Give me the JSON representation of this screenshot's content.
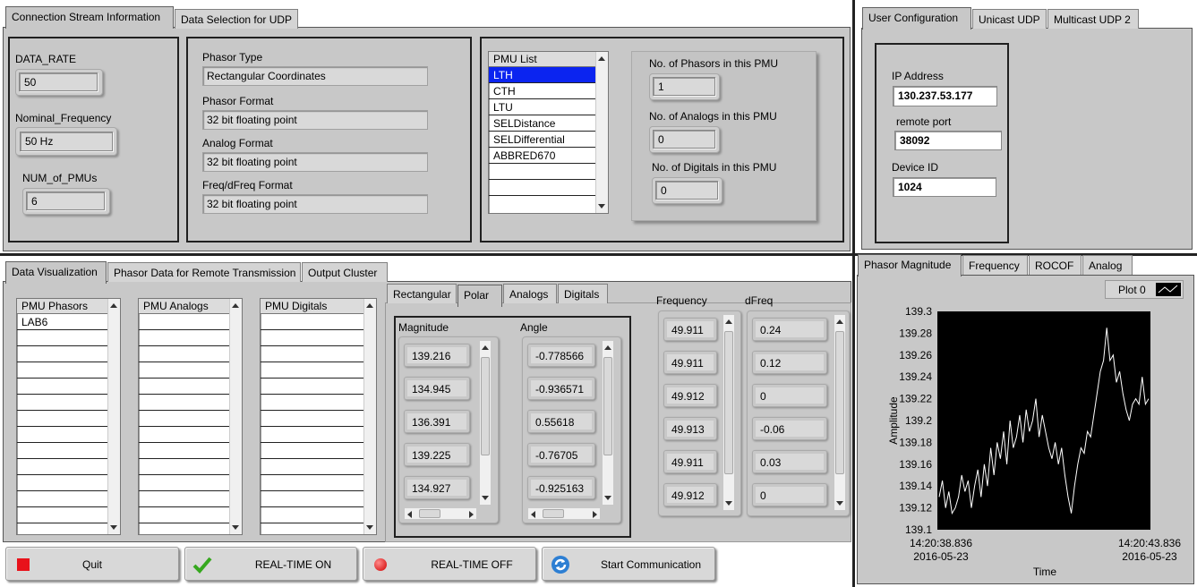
{
  "top_left_tabs": [
    "Connection Stream Information",
    "Data Selection for UDP"
  ],
  "stream": {
    "data_rate_label": "DATA_RATE",
    "data_rate": "50",
    "nominal_freq_label": "Nominal_Frequency",
    "nominal_freq": "50 Hz",
    "num_pmus_label": "NUM_of_PMUs",
    "num_pmus": "6",
    "phasor_type_label": "Phasor Type",
    "phasor_type": "Rectangular Coordinates",
    "phasor_format_label": "Phasor Format",
    "phasor_format": "32 bit floating point",
    "analog_format_label": "Analog Format",
    "analog_format": "32 bit floating point",
    "freq_format_label": "Freq/dFreq Format",
    "freq_format": "32 bit floating point"
  },
  "pmu_list": {
    "header": "PMU List",
    "items": [
      "LTH",
      "CTH",
      "LTU",
      "SELDistance",
      "SELDifferential",
      "ABBRED670"
    ],
    "selected": "LTH"
  },
  "pmu_counts": {
    "phasors_label": "No. of Phasors in this PMU",
    "phasors": "1",
    "analogs_label": "No. of Analogs in this PMU",
    "analogs": "0",
    "digitals_label": "No. of Digitals in this PMU",
    "digitals": "0"
  },
  "right_tabs": [
    "User Configuration",
    "Unicast UDP",
    "Multicast UDP 2"
  ],
  "user_config": {
    "ip_label": "IP Address",
    "ip": "130.237.53.177",
    "port_label": "remote port",
    "port": "38092",
    "device_label": "Device ID",
    "device": "1024"
  },
  "bottom_tabs": [
    "Data Visualization",
    "Phasor Data for Remote Transmission",
    "Output Cluster"
  ],
  "lists": {
    "phasors_header": "PMU Phasors",
    "phasors": [
      "LAB6"
    ],
    "analogs_header": "PMU Analogs",
    "digitals_header": "PMU Digitals"
  },
  "coord_tabs": [
    "Rectangular",
    "Polar",
    "Analogs",
    "Digitals"
  ],
  "polar": {
    "magnitude_label": "Magnitude",
    "magnitudes": [
      "139.216",
      "134.945",
      "136.391",
      "139.225",
      "134.927"
    ],
    "angle_label": "Angle",
    "angles": [
      "-0.778566",
      "-0.936571",
      "0.55618",
      "-0.76705",
      "-0.925163"
    ]
  },
  "freq": {
    "freq_label": "Frequency",
    "freqs": [
      "49.911",
      "49.911",
      "49.912",
      "49.913",
      "49.911",
      "49.912"
    ],
    "dfreq_label": "dFreq",
    "dfreqs": [
      "0.24",
      "0.12",
      "0",
      "-0.06",
      "0.03",
      "0"
    ]
  },
  "buttons": {
    "quit": "Quit",
    "rt_on": "REAL-TIME ON",
    "rt_off": "REAL-TIME OFF",
    "start": "Start Communication"
  },
  "chart_tabs": [
    "Phasor Magnitude",
    "Frequency",
    "ROCOF",
    "Analog"
  ],
  "legend": "Plot 0",
  "chart_data": {
    "type": "line",
    "xlabel": "Time",
    "ylabel": "Amplitude",
    "ylim": [
      139.1,
      139.3
    ],
    "y_ticks": [
      "139.3",
      "139.28",
      "139.26",
      "139.24",
      "139.22",
      "139.2",
      "139.18",
      "139.16",
      "139.14",
      "139.12",
      "139.1"
    ],
    "x_start": [
      "14:20:38.836",
      "2016-05-23"
    ],
    "x_end": [
      "14:20:43.836",
      "2016-05-23"
    ],
    "grid": false,
    "line_color": "#ffffff",
    "background": "#000000",
    "series": [
      {
        "name": "Plot 0",
        "values": [
          139.13,
          139.145,
          139.12,
          139.135,
          139.115,
          139.12,
          139.13,
          139.15,
          139.135,
          139.145,
          139.12,
          139.14,
          139.155,
          139.13,
          139.16,
          139.14,
          139.175,
          139.15,
          139.18,
          139.165,
          139.19,
          139.16,
          139.2,
          139.175,
          139.185,
          139.205,
          139.18,
          139.21,
          139.19,
          139.2,
          139.22,
          139.185,
          139.205,
          139.19,
          139.175,
          139.165,
          139.18,
          139.16,
          139.175,
          139.15,
          139.13,
          139.115,
          139.14,
          139.16,
          139.175,
          139.17,
          139.19,
          139.185,
          139.205,
          139.225,
          139.245,
          139.255,
          139.285,
          139.255,
          139.26,
          139.235,
          139.245,
          139.225,
          139.21,
          139.2,
          139.215,
          139.22,
          139.215,
          139.24,
          139.215,
          139.22
        ]
      }
    ]
  }
}
